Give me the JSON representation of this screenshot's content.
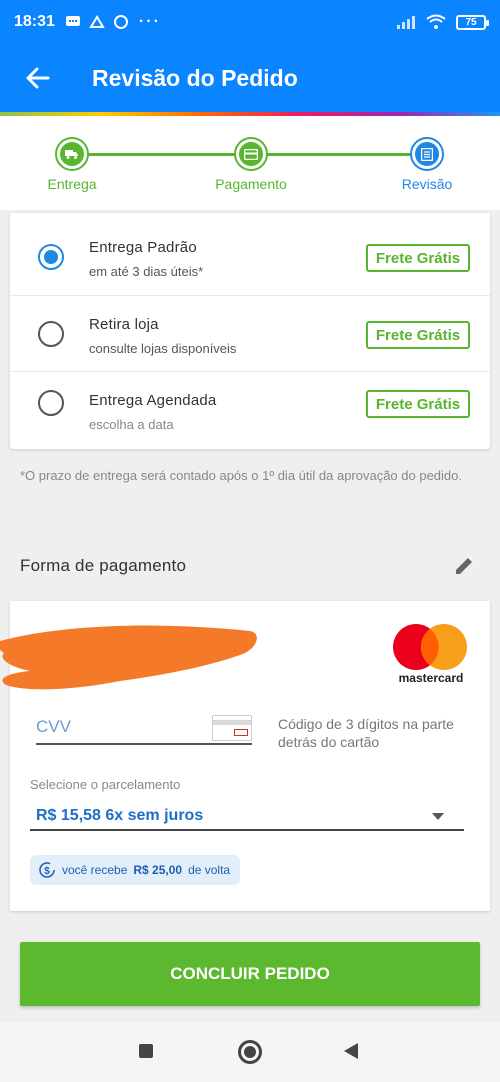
{
  "status_bar": {
    "time": "18:31",
    "battery": "75",
    "dots": "···"
  },
  "header": {
    "title": "Revisão do Pedido"
  },
  "stepper": {
    "steps": [
      {
        "label": "Entrega",
        "icon": "truck-icon"
      },
      {
        "label": "Pagamento",
        "icon": "credit-card-icon"
      },
      {
        "label": "Revisão",
        "icon": "document-icon"
      }
    ]
  },
  "delivery": {
    "options": [
      {
        "title": "Entrega Padrão",
        "subtitle": "em até 3 dias úteis*",
        "badge": "Frete Grátis",
        "selected": true
      },
      {
        "title": "Retira loja",
        "subtitle": "consulte lojas disponíveis",
        "badge": "Frete Grátis",
        "selected": false
      },
      {
        "title": "Entrega Agendada",
        "subtitle": "escolha a data",
        "badge": "Frete Grátis",
        "selected": false
      }
    ],
    "note": "*O prazo de entrega será contado após o 1º dia útil da aprovação do pedido."
  },
  "payment": {
    "section_title": "Forma de pagamento",
    "card_brand": "mastercard",
    "cvv_placeholder": "CVV",
    "cvv_hint": "Código de 3 dígitos na parte detrás do cartão",
    "installment_label": "Selecione o parcelamento",
    "installment_value": "R$ 15,58 6x sem juros",
    "cashback_prefix": "você recebe",
    "cashback_amount": "R$ 25,00",
    "cashback_suffix": "de volta"
  },
  "actions": {
    "submit_label": "CONCLUIR PEDIDO"
  },
  "colors": {
    "primary_blue": "#0a84ff",
    "success_green": "#58b52f",
    "link_blue": "#1e6ec8"
  }
}
